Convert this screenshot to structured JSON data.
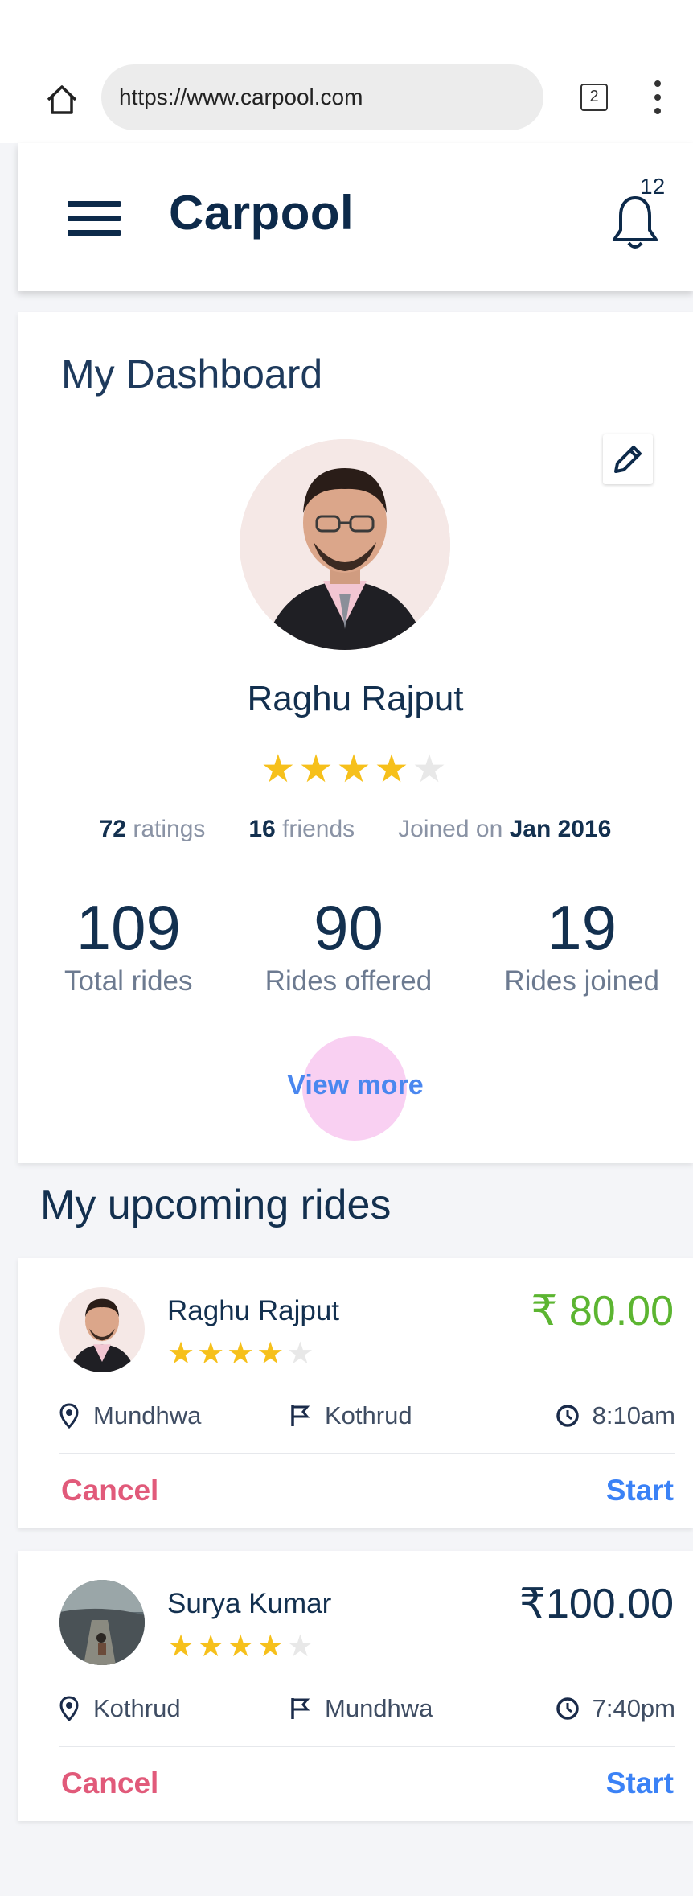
{
  "browser": {
    "url": "https://www.carpool.com",
    "tab_count": "2"
  },
  "app": {
    "title": "Carpool",
    "notification_count": "12"
  },
  "dashboard": {
    "title": "My Dashboard",
    "user_name": "Raghu Rajput",
    "rating_stars": 4,
    "ratings_count": "72",
    "ratings_label": "ratings",
    "friends_count": "16",
    "friends_label": "friends",
    "joined_label": "Joined on",
    "joined_date": "Jan 2016",
    "stats": [
      {
        "value": "109",
        "label": "Total rides"
      },
      {
        "value": "90",
        "label": "Rides offered"
      },
      {
        "value": "19",
        "label": "Rides joined"
      }
    ],
    "view_more": "View more"
  },
  "upcoming": {
    "title": "My upcoming rides",
    "rides": [
      {
        "name": "Raghu Rajput",
        "stars": 4,
        "price": "₹ 80.00",
        "price_color": "#5cb531",
        "from": "Mundhwa",
        "to": "Kothrud",
        "time": "8:10am",
        "cancel": "Cancel",
        "start": "Start"
      },
      {
        "name": "Surya Kumar",
        "stars": 4,
        "price": "₹100.00",
        "price_color": "#13304f",
        "from": "Kothrud",
        "to": "Mundhwa",
        "time": "7:40pm",
        "cancel": "Cancel",
        "start": "Start"
      }
    ]
  },
  "icons": {
    "home": "home-icon",
    "menu": "menu-icon",
    "bell": "bell-icon",
    "edit": "pencil-icon",
    "pin": "location-pin-icon",
    "flag": "flag-icon",
    "clock": "clock-icon",
    "more": "kebab-menu-icon"
  },
  "colors": {
    "brand": "#0d2a4a",
    "star": "#f6c01b",
    "cancel": "#e15a7a",
    "start": "#3b82f6",
    "view_more": "#4a87ef"
  }
}
